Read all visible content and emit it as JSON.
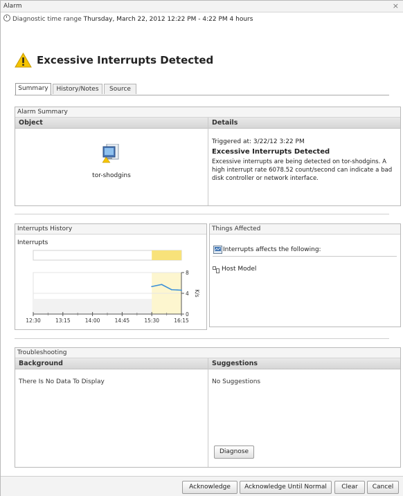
{
  "window": {
    "title": "Alarm",
    "close_glyph": "×"
  },
  "time_range": {
    "label": "Diagnostic time range",
    "value": "Thursday, March 22, 2012  12:22 PM - 4:22 PM  4 hours",
    "icon": "clock-icon"
  },
  "alarm": {
    "title": "Excessive Interrupts Detected",
    "icon": "warning-icon",
    "warning_color": "#f5c400"
  },
  "tabs": [
    {
      "label": "Summary",
      "active": true
    },
    {
      "label": "History/Notes",
      "active": false
    },
    {
      "label": "Source",
      "active": false
    }
  ],
  "alarm_summary": {
    "title": "Alarm Summary",
    "col_object": "Object",
    "col_details": "Details",
    "object_name": "tor-shodgins",
    "object_icon": "host-computer-icon",
    "triggered": "Triggered at: 3/22/12 3:22 PM",
    "details_title": "Excessive Interrupts Detected",
    "details_text": "Excessive interrupts are being detected on tor-shodgins. A high interrupt rate 6078.52 count/second can indicate a bad disk controller or network interface."
  },
  "interrupts_history": {
    "title": "Interrupts History",
    "chart_label": "Interrupts"
  },
  "things_affected": {
    "title": "Things Affected",
    "heading": "Interrupts affects the following:",
    "items": [
      "Host Model"
    ]
  },
  "troubleshooting": {
    "title": "Troubleshooting",
    "col_background": "Background",
    "col_suggestions": "Suggestions",
    "background_text": "There Is No Data To Display",
    "suggestions_text": "No Suggestions",
    "diagnose_label": "Diagnose"
  },
  "buttons": {
    "acknowledge": "Acknowledge",
    "acknowledge_until_normal": "Acknowledge Until Normal",
    "clear": "Clear",
    "cancel": "Cancel"
  },
  "chart_data": {
    "type": "line",
    "series": [
      {
        "x": [
          "15:30",
          "15:45",
          "16:00",
          "16:15"
        ],
        "values": [
          5.3,
          5.7,
          4.7,
          4.6
        ]
      }
    ],
    "x_ticks": [
      "12:30",
      "13:15",
      "14:00",
      "14:45",
      "15:30",
      "16:15"
    ],
    "y_ticks": [
      "0",
      "4",
      "8"
    ],
    "ylabel": "K/s",
    "ylim": [
      0,
      8
    ],
    "highlight_range": [
      "15:30",
      "16:15"
    ],
    "line_color": "#3a8fd8",
    "highlight_color": "#fdf6cf",
    "grid": true
  }
}
